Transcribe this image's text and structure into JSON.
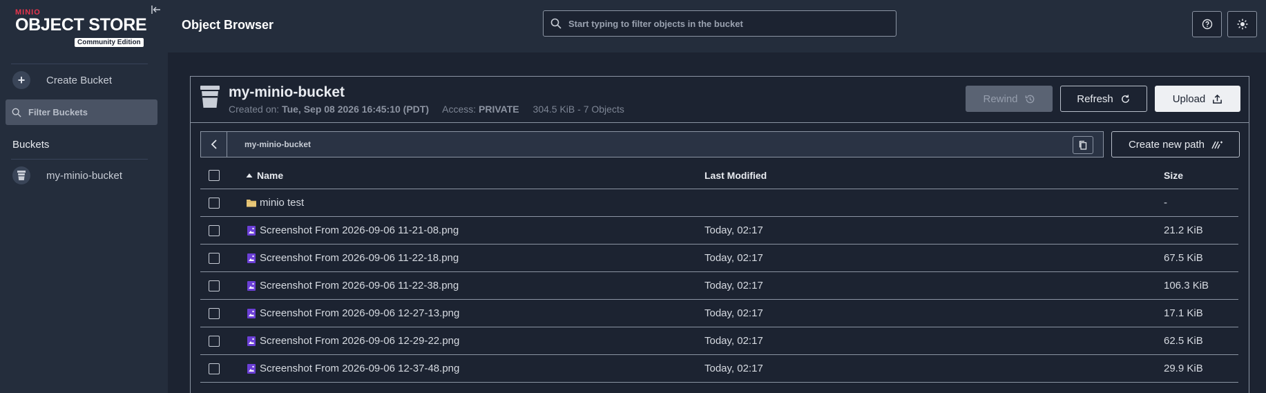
{
  "sidebar": {
    "logo_brand": "MINIO",
    "logo_title": "OBJECT STORE",
    "logo_badge": "Community Edition",
    "create_bucket_label": "Create Bucket",
    "filter_placeholder": "Filter Buckets",
    "buckets_heading": "Buckets",
    "buckets": [
      {
        "label": "my-minio-bucket"
      }
    ]
  },
  "header": {
    "title": "Object Browser",
    "search_placeholder": "Start typing to filter objects in the bucket"
  },
  "bucket": {
    "name": "my-minio-bucket",
    "created_label": "Created on:",
    "created_value": "Tue, Sep 08 2026 16:45:10 (PDT)",
    "access_label": "Access:",
    "access_value": "PRIVATE",
    "usage": "304.5 KiB - 7 Objects"
  },
  "actions": {
    "rewind": "Rewind",
    "refresh": "Refresh",
    "upload": "Upload",
    "create_new_path": "Create new path"
  },
  "breadcrumb": {
    "path": "my-minio-bucket"
  },
  "table": {
    "columns": {
      "name": "Name",
      "last_modified": "Last Modified",
      "size": "Size"
    },
    "rows": [
      {
        "type": "folder",
        "name": "minio test",
        "modified": "",
        "size": "-"
      },
      {
        "type": "image",
        "name": "Screenshot From 2026-09-06 11-21-08.png",
        "modified": "Today, 02:17",
        "size": "21.2 KiB"
      },
      {
        "type": "image",
        "name": "Screenshot From 2026-09-06 11-22-18.png",
        "modified": "Today, 02:17",
        "size": "67.5 KiB"
      },
      {
        "type": "image",
        "name": "Screenshot From 2026-09-06 11-22-38.png",
        "modified": "Today, 02:17",
        "size": "106.3 KiB"
      },
      {
        "type": "image",
        "name": "Screenshot From 2026-09-06 12-27-13.png",
        "modified": "Today, 02:17",
        "size": "17.1 KiB"
      },
      {
        "type": "image",
        "name": "Screenshot From 2026-09-06 12-29-22.png",
        "modified": "Today, 02:17",
        "size": "62.5 KiB"
      },
      {
        "type": "image",
        "name": "Screenshot From 2026-09-06 12-37-48.png",
        "modified": "Today, 02:17",
        "size": "29.9 KiB"
      }
    ]
  },
  "colors": {
    "background": "#1c2331",
    "sidebar": "#242d3c",
    "brand_red": "#e8344c",
    "image_icon": "#6b3fd6",
    "folder_icon": "#e8c778"
  }
}
